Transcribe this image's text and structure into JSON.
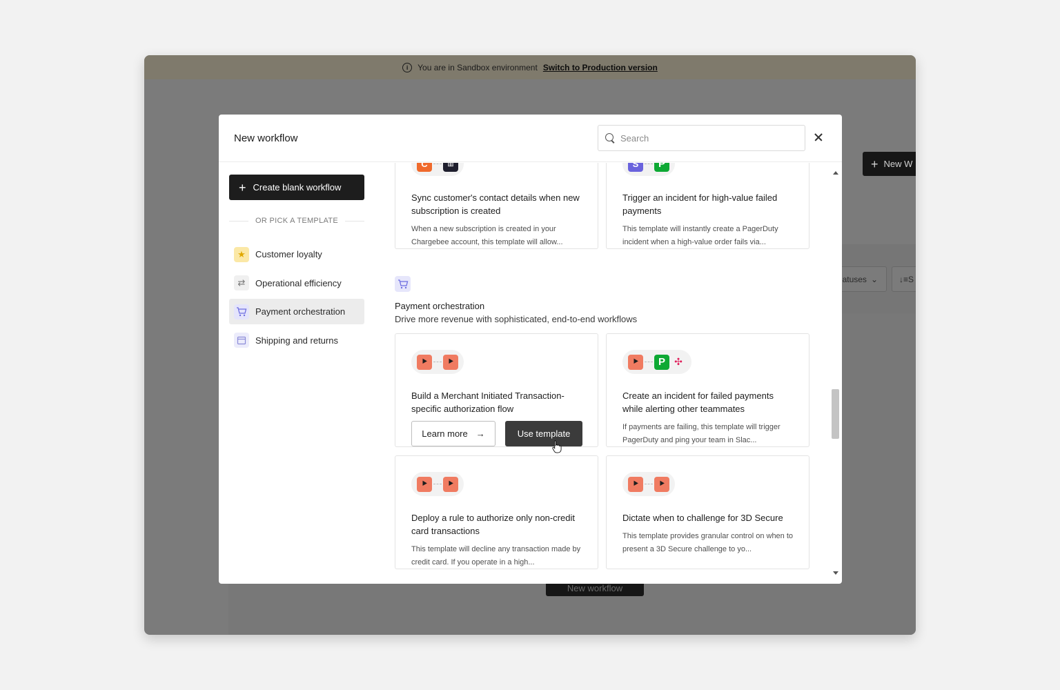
{
  "banner": {
    "text": "You are in Sandbox environment",
    "link": "Switch to Production version",
    "icon": "info-icon"
  },
  "background": {
    "new_button": "New W",
    "filter_label": "atuses",
    "sort_label": "S",
    "empty_button": "New workflow"
  },
  "modal": {
    "title": "New workflow",
    "search_placeholder": "Search",
    "close_icon": "close-icon"
  },
  "sidebar": {
    "create_blank": "Create blank workflow",
    "divider": "OR PICK A TEMPLATE",
    "items": [
      {
        "label": "Customer loyalty",
        "icon": "star-icon"
      },
      {
        "label": "Operational efficiency",
        "icon": "cycle-icon"
      },
      {
        "label": "Payment orchestration",
        "icon": "cart-icon",
        "active": true
      },
      {
        "label": "Shipping and returns",
        "icon": "box-icon"
      }
    ]
  },
  "section": {
    "title": "Payment orchestration",
    "subtitle": "Drive more revenue with sophisticated, end-to-end workflows",
    "icon": "cart-icon"
  },
  "cards": [
    {
      "title": "Sync customer's contact details when new subscription is created",
      "desc": "When a new subscription is created in your Chargebee account, this template will allow...",
      "icons": [
        "chargebee-logo",
        "intercom-logo"
      ]
    },
    {
      "title": "Trigger an incident for high-value failed payments",
      "desc": "This template will instantly create a PagerDuty incident when a high-value order fails via...",
      "icons": [
        "stripe-logo",
        "pagerduty-logo"
      ]
    },
    {
      "title": "Build a Merchant Initiated Transaction-specific authorization flow",
      "learn_more": "Learn more",
      "use_template": "Use template",
      "icons": [
        "route-logo",
        "route-logo"
      ]
    },
    {
      "title": "Create an incident for failed payments while alerting other teammates",
      "desc": "If payments are failing, this template will trigger PagerDuty and ping your team in Slac...",
      "icons": [
        "route-logo",
        "pagerduty-logo",
        "slack-logo"
      ]
    },
    {
      "title": "Deploy a rule to authorize only non-credit card transactions",
      "desc": "This template will decline any transaction made by credit card. If you operate in a high...",
      "icons": [
        "route-logo",
        "route-logo"
      ]
    },
    {
      "title": "Dictate when to challenge for 3D Secure",
      "desc": "This template provides granular control on when to present a 3D Secure challenge to yo...",
      "icons": [
        "route-logo",
        "route-logo"
      ]
    }
  ]
}
